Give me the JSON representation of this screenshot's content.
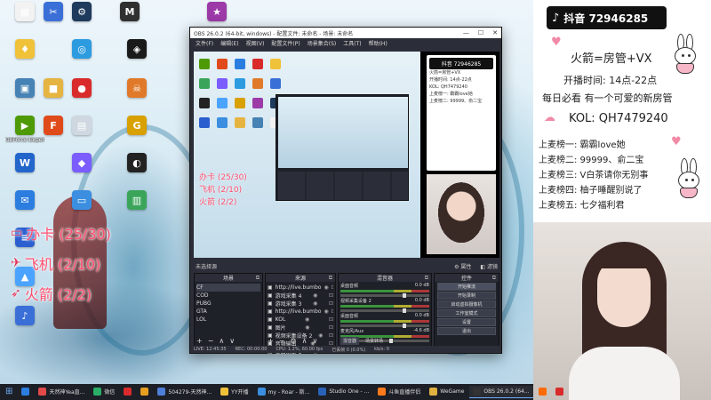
{
  "desktop": {
    "icons": [
      {
        "label": "",
        "color": "#f2f2f2",
        "glyph": "▦"
      },
      {
        "label": "",
        "color": "#3b6fd8",
        "glyph": "✂"
      },
      {
        "label": "",
        "color": "#1e3a5c",
        "glyph": "⚙"
      },
      {
        "label": "",
        "color": "#303030",
        "glyph": "M"
      },
      {
        "label": "",
        "color": "#9c3aa8",
        "glyph": "★"
      },
      {
        "label": "",
        "color": "#f0c23a",
        "glyph": "♦"
      },
      {
        "label": "",
        "color": "#2c9be0",
        "glyph": "◎"
      },
      {
        "label": "",
        "color": "#1a1a1a",
        "glyph": "◈"
      },
      {
        "label": "",
        "color": "#4682b4",
        "glyph": "▣"
      },
      {
        "label": "",
        "color": "#e6b440",
        "glyph": "■"
      },
      {
        "label": "",
        "color": "#d92b2b",
        "glyph": "●"
      },
      {
        "label": "",
        "color": "#e07a2a",
        "glyph": "☠"
      },
      {
        "label": "GeForce Experience",
        "color": "#4e9a06",
        "glyph": "▶"
      },
      {
        "label": "",
        "color": "#e04a1a",
        "glyph": "F"
      },
      {
        "label": "",
        "color": "#cfd8e0",
        "glyph": "▤"
      },
      {
        "label": "",
        "color": "#d8a000",
        "glyph": "G"
      },
      {
        "label": "",
        "color": "#2266cc",
        "glyph": "W"
      },
      {
        "label": "",
        "color": "#7a5cff",
        "glyph": "◆"
      },
      {
        "label": "",
        "color": "#222",
        "glyph": "◐"
      },
      {
        "label": "",
        "color": "#2b7de0",
        "glyph": "✉"
      },
      {
        "label": "",
        "color": "#3b8ee0",
        "glyph": "▭"
      },
      {
        "label": "",
        "color": "#3aa55a",
        "glyph": "▥"
      },
      {
        "label": "",
        "color": "#2b5fd0",
        "glyph": "≡"
      },
      {
        "label": "",
        "color": "#4aa3ff",
        "glyph": "▲"
      },
      {
        "label": "",
        "color": "#3a6fd8",
        "glyph": "♪"
      }
    ]
  },
  "overlay": {
    "counters": [
      {
        "label": "办卡 (25/30)",
        "icon": "card-icon"
      },
      {
        "label": "飞机 (2/10)",
        "icon": "plane-icon"
      },
      {
        "label": "火箭 (2/2)",
        "icon": "rocket-icon"
      }
    ]
  },
  "obs": {
    "title": "OBS 26.0.2 (64-bit, windows) - 配置文件: 未命名 - 场景: 未命名",
    "menu": [
      "文件(F)",
      "编辑(E)",
      "视图(V)",
      "配置文件(P)",
      "场景集合(S)",
      "工具(T)",
      "帮助(H)"
    ],
    "toolbar_left": "未选择源",
    "toolbar_props": "属性",
    "toolbar_filters": "滤镜",
    "preview_counters": [
      "办卡 (25/30)",
      "飞机 (2/10)",
      "火箭 (2/2)"
    ],
    "preview_panel": {
      "badge": "抖音 72946285",
      "lines": [
        "火箭=房管+VX",
        "开播时间: 14点-22点",
        "KOL: QH7479240",
        "上麦榜一: 霸霸love她",
        "上麦榜二: 99999、俞二宝"
      ]
    },
    "docks": {
      "scenes": {
        "title": "场景",
        "items": [
          "CF",
          "COD",
          "PUBG",
          "GTA",
          "LOL"
        ]
      },
      "sources": {
        "title": "来源",
        "items": [
          "http://live.bumbo",
          "游戏采集 4",
          "游戏采集 3",
          "http://live.bumbo",
          "KOL",
          "图片",
          "视频采集设备 2",
          "音频输出",
          "桌面采集 1"
        ]
      },
      "mixer": {
        "title": "混音器",
        "tracks": [
          {
            "name": "桌面音频",
            "db": "0.0 dB"
          },
          {
            "name": "视频采集设备 2",
            "db": "0.0 dB"
          },
          {
            "name": "桌面音频",
            "db": "0.0 dB"
          },
          {
            "name": "麦克风/Aux",
            "db": "-4.6 dB"
          }
        ]
      },
      "transitions": {
        "title": "转场",
        "items": [
          "混音器",
          "场景转场"
        ]
      },
      "controls": {
        "title": "控件",
        "buttons": [
          "开始推流",
          "开始录制",
          "启动虚拟摄像机",
          "工作室模式",
          "设置",
          "退出"
        ]
      }
    },
    "status": [
      "LIVE: 12:45:35",
      "REC: 00:00:00",
      "CPU: 1.2%, 60.00 fps",
      "已丢帧 0 (0.0%)",
      "kb/s: 0"
    ]
  },
  "stream_panel": {
    "badge": "抖音 72946285",
    "title_line": "火箭=房管+VX",
    "schedule_line": "开播时间: 14点-22点",
    "notice_line": "每日必看 有一个可爱的新房管",
    "kol_line": "KOL: QH7479240",
    "ranks": [
      "上麦榜一: 霸霸love她",
      "上麦榜二: 99999、俞二宝",
      "上麦榜三: V白茶请你无别事",
      "上麦榜四: 柚子睡醒别说了",
      "上麦榜五: 七夕福利君"
    ]
  },
  "taskbar": {
    "items": [
      {
        "label": "",
        "color": "#2b7de0",
        "active": false
      },
      {
        "label": "天然神Yea直...",
        "color": "#e24a4a",
        "active": false
      },
      {
        "label": "微信",
        "color": "#2aae67",
        "active": false
      },
      {
        "label": "",
        "color": "#d92b2b",
        "active": false
      },
      {
        "label": "",
        "color": "#e8a020",
        "active": false
      },
      {
        "label": "504279-天然神...",
        "color": "#4e7fd8",
        "active": false
      },
      {
        "label": "YY开播",
        "color": "#f0c23a",
        "active": false
      },
      {
        "label": "my - Roar - 斯...",
        "color": "#3b8ee0",
        "active": false
      },
      {
        "label": "Studio One - ...",
        "color": "#2a62b8",
        "active": false
      },
      {
        "label": "斗鱼直播伴侣",
        "color": "#ff7a1a",
        "active": false
      },
      {
        "label": "WeGame",
        "color": "#e0b040",
        "active": false
      },
      {
        "label": "OBS 26.0.2 (64...",
        "color": "#333",
        "active": true
      },
      {
        "label": "",
        "color": "#ff6a00",
        "active": false
      },
      {
        "label": "",
        "color": "#d92b2b",
        "active": false
      }
    ]
  }
}
